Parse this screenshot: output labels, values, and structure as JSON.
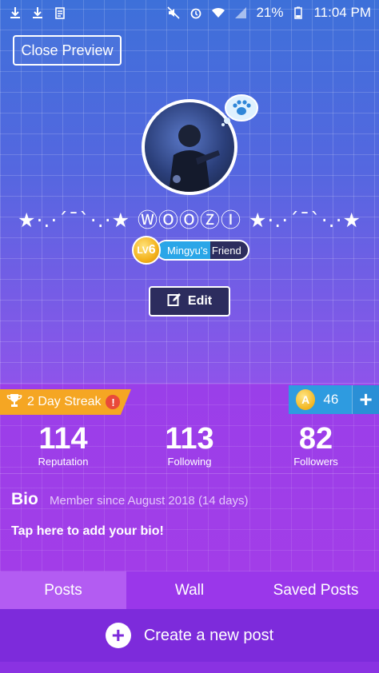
{
  "status_bar": {
    "battery": "21%",
    "time": "11:04 PM",
    "icons_left": [
      "download-icon",
      "download-icon",
      "clipboard-icon"
    ],
    "icons_right": [
      "mute-icon",
      "alarm-icon",
      "wifi-icon",
      "signal-icon",
      "battery-icon"
    ]
  },
  "header": {
    "close_preview_label": "Close Preview"
  },
  "profile": {
    "username": "★·.·´¯`·.·★ ⓌⓄⓄⓏⒾ ★·.·´¯`·.·★",
    "level_prefix": "LV",
    "level": "6",
    "friend_name": "Mingyu's",
    "friend_suffix": "Friend",
    "edit_label": "Edit"
  },
  "streak": {
    "label": "2 Day Streak",
    "alert": "!"
  },
  "coins": {
    "symbol": "A",
    "count": "46",
    "plus": "+"
  },
  "stats": [
    {
      "value": "114",
      "label": "Reputation"
    },
    {
      "value": "113",
      "label": "Following"
    },
    {
      "value": "82",
      "label": "Followers"
    }
  ],
  "bio": {
    "title": "Bio",
    "member_since": "Member since August 2018 (14 days)",
    "add_prompt": "Tap here to add your bio!"
  },
  "tabs": [
    {
      "label": "Posts",
      "active": true
    },
    {
      "label": "Wall",
      "active": false
    },
    {
      "label": "Saved Posts",
      "active": false
    }
  ],
  "create_post": {
    "label": "Create a new post"
  },
  "colors": {
    "streak": "#f5a623",
    "coins": "#2e9be0",
    "friend_tag": "#2aa6e8",
    "tab_active": "#b35cf2"
  }
}
